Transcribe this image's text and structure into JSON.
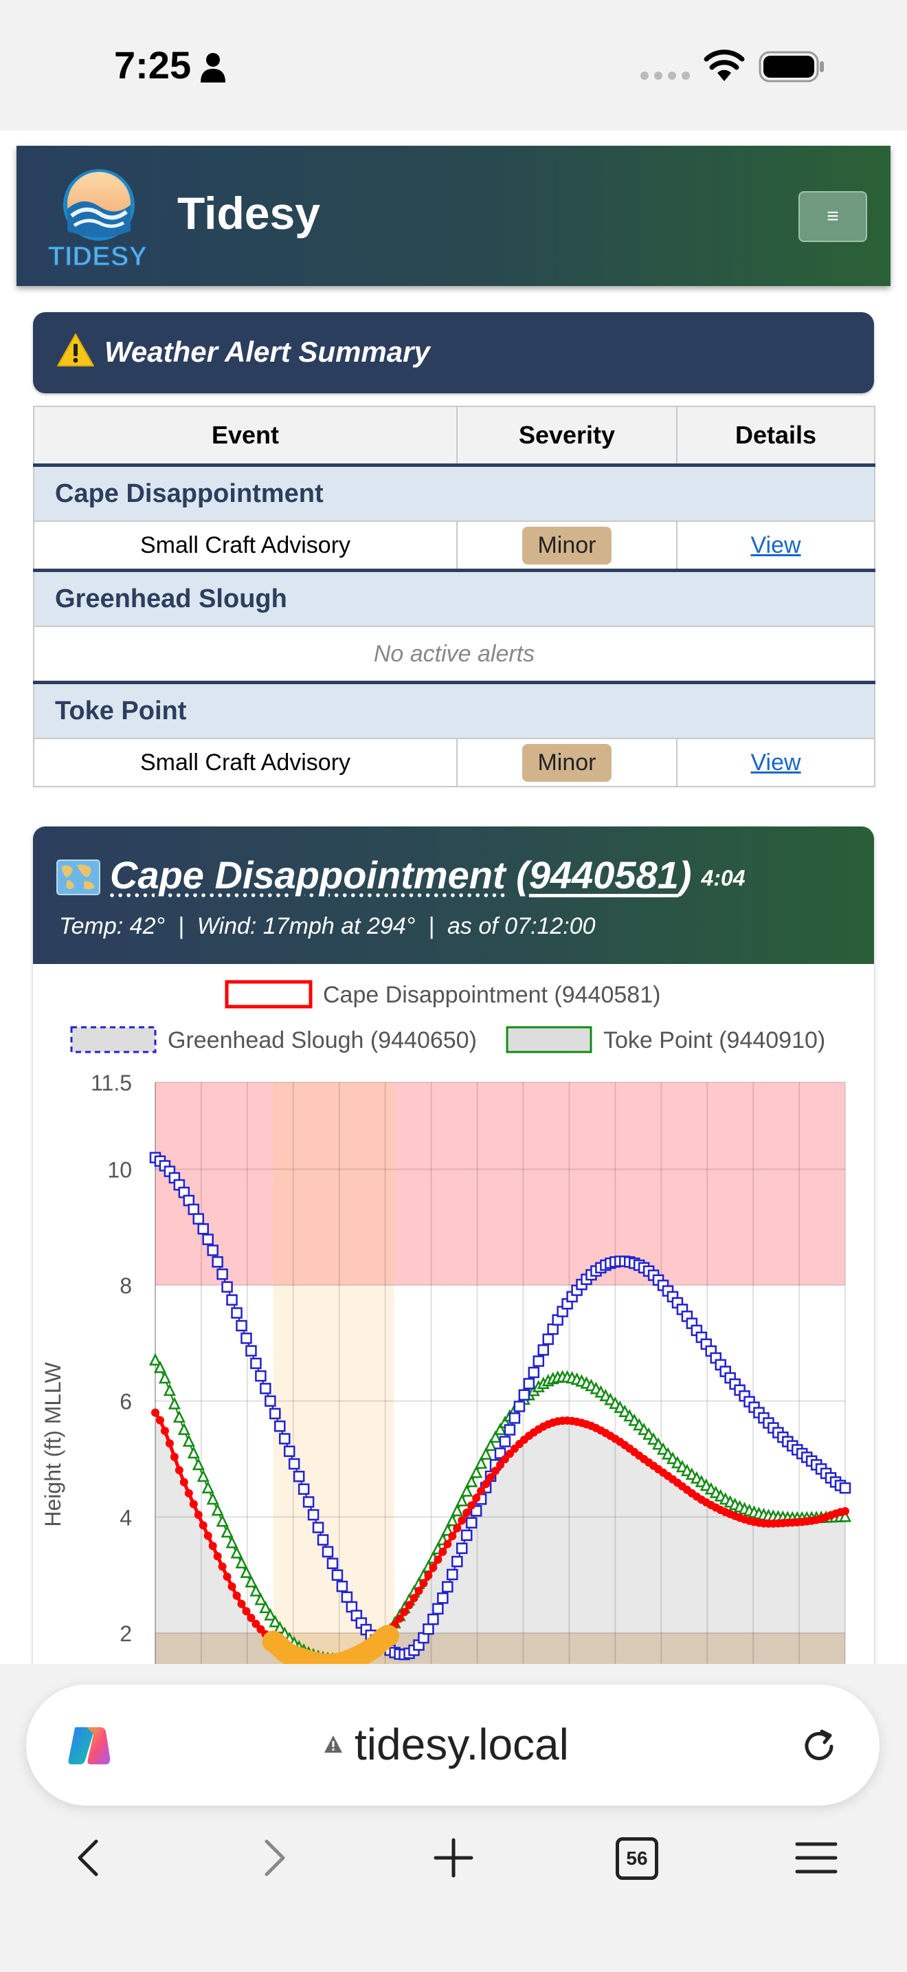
{
  "status_bar": {
    "time": "7:25"
  },
  "header": {
    "site_title": "Tidesy",
    "logo_text": "TIDESY",
    "menu_label": "≡"
  },
  "alert_summary": {
    "title": "Weather Alert Summary",
    "columns": [
      "Event",
      "Severity",
      "Details"
    ],
    "stations": [
      {
        "name": "Cape Disappointment",
        "event": "Small Craft Advisory",
        "severity": "Minor",
        "details": "View"
      },
      {
        "name": "Greenhead Slough",
        "message": "No active alerts"
      },
      {
        "name": "Toke Point",
        "event": "Small Craft Advisory",
        "severity": "Minor",
        "details": "View"
      }
    ]
  },
  "station_card": {
    "station_name": "Cape Disappointment",
    "station_id": "9440581",
    "time": "4:04",
    "temp": "Temp: 42°",
    "wind": "Wind: 17mph at 294°",
    "as_of": "as of 07:12:00",
    "separator": "|"
  },
  "chart_data": {
    "type": "line",
    "ylabel": "Height (ft) MLLW",
    "y_ticks": [
      2,
      4,
      6,
      8,
      10,
      11.5
    ],
    "ylim": [
      1.4,
      11.5
    ],
    "xlim": [
      0,
      24
    ],
    "grid": true,
    "legend_position": "top",
    "bands": [
      {
        "from": 8,
        "to": 11.5,
        "color": "#ffc9cc"
      },
      {
        "from": 0,
        "to": 2,
        "color": "#ecd9c2"
      }
    ],
    "highlight_x_range": [
      4.1,
      8.3
    ],
    "series": [
      {
        "name": "Cape Disappointment (9440581)",
        "color": "#ff0000",
        "marker": "circle",
        "x": [
          0,
          1,
          2,
          3,
          4,
          5,
          6,
          7,
          8,
          9,
          10,
          11,
          12,
          13,
          14,
          15,
          16,
          17,
          18,
          19,
          20,
          21,
          22,
          23,
          24
        ],
        "y": [
          5.8,
          4.6,
          3.5,
          2.5,
          1.9,
          1.6,
          1.45,
          1.6,
          1.95,
          2.6,
          3.4,
          4.2,
          4.9,
          5.4,
          5.65,
          5.6,
          5.35,
          5.0,
          4.65,
          4.3,
          4.05,
          3.9,
          3.9,
          3.95,
          4.1
        ]
      },
      {
        "name": "Greenhead Slough (9440650)",
        "color": "#2222cc",
        "marker": "square",
        "x": [
          0,
          1,
          2,
          3,
          4,
          5,
          6,
          7,
          8,
          9,
          10,
          11,
          12,
          13,
          14,
          15,
          16,
          17,
          18,
          19,
          20,
          21,
          22,
          23,
          24
        ],
        "y": [
          10.2,
          9.6,
          8.6,
          7.3,
          6.0,
          4.7,
          3.4,
          2.3,
          1.75,
          1.7,
          2.6,
          3.9,
          5.1,
          6.3,
          7.4,
          8.1,
          8.4,
          8.3,
          7.8,
          7.1,
          6.4,
          5.8,
          5.3,
          4.9,
          4.5
        ]
      },
      {
        "name": "Toke Point (9440910)",
        "color": "#138a13",
        "marker": "triangle",
        "x": [
          0,
          1,
          2,
          3,
          4,
          5,
          6,
          7,
          8,
          9,
          10,
          11,
          12,
          13,
          14,
          15,
          16,
          17,
          18,
          19,
          20,
          21,
          22,
          23,
          24
        ],
        "y": [
          6.7,
          5.5,
          4.3,
          3.2,
          2.3,
          1.75,
          1.55,
          1.6,
          1.95,
          2.7,
          3.6,
          4.6,
          5.5,
          6.1,
          6.4,
          6.3,
          5.95,
          5.5,
          5.0,
          4.6,
          4.25,
          4.05,
          3.98,
          3.98,
          4.0
        ]
      }
    ],
    "highlight_series": {
      "color": "#f7a928",
      "x": [
        4.1,
        4.6,
        5.1,
        5.6,
        6.1,
        6.6,
        7.1,
        7.6,
        8.1
      ],
      "y": [
        1.85,
        1.65,
        1.55,
        1.48,
        1.45,
        1.5,
        1.6,
        1.75,
        1.95
      ]
    }
  },
  "browser": {
    "url": "tidesy.local",
    "tab_count": "56"
  }
}
